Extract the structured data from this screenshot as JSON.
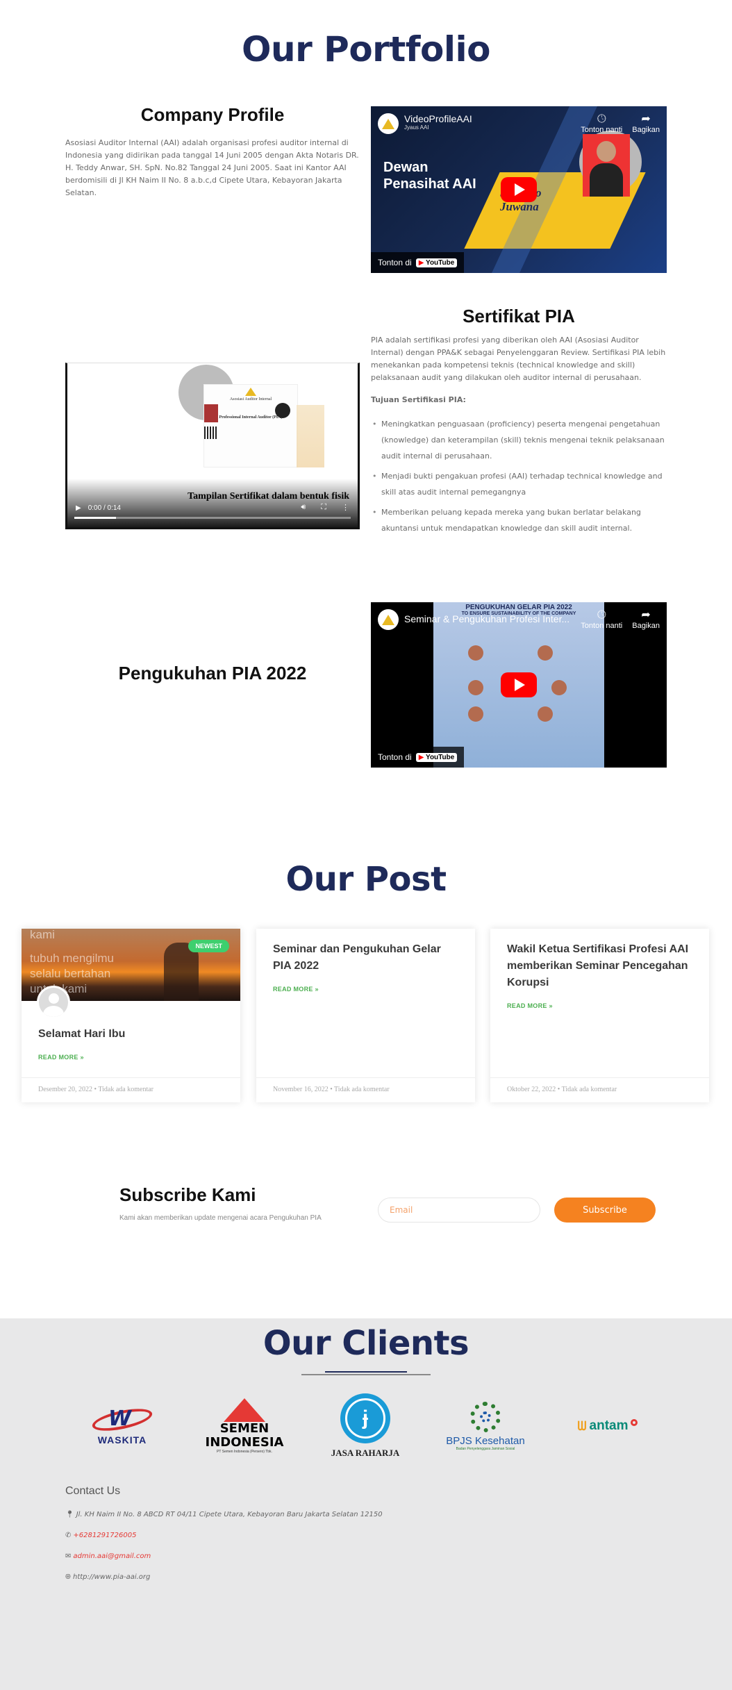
{
  "portfolio": {
    "title": "Our Portfolio",
    "company_profile": {
      "heading": "Company Profile",
      "text": "Asosiasi Auditor Internal (AAI) adalah organisasi profesi auditor internal di Indonesia yang didirikan pada tanggal 14 Juni 2005 dengan Akta Notaris DR. H. Teddy Anwar, SH. SpN. No.82 Tanggal 24 Juni 2005.   Saat ini Kantor AAI berdomisili di Jl KH Naim II No. 8 a.b.c,d Cipete Utara, Kebayoran Jakarta Selatan.",
      "video": {
        "channel_title": "VideoProfileAAI",
        "channel_sub": "Jyaus AAI",
        "watch_later": "Tonton nanti",
        "share": "Bagikan",
        "overlay_line1": "Dewan",
        "overlay_line2": "Penasihat AAI",
        "overlay_name": "Suhanto Juwana",
        "watch_on": "Tonton di",
        "yt_brand": "YouTube"
      }
    },
    "sertifikat": {
      "heading": "Sertifikat PIA",
      "text": "PIA adalah sertifikasi profesi yang diberikan oleh AAI (Asosiasi Auditor Internal) dengan PPA&K sebagai Penyelenggaran Review.  Sertifikasi PIA lebih menekankan pada kompetensi teknis (technical knowledge and skill) pelaksanaan audit yang dilakukan oleh auditor internal di perusahaan.",
      "goals_heading": "Tujuan Sertifikasi PIA:",
      "goals": [
        "Meningkatkan penguasaan (proficiency) peserta mengenai pengetahuan (knowledge) dan keterampilan (skill) teknis mengenai teknik pelaksanaan audit internal di perusahaan.",
        "Menjadi bukti pengakuan profesi (AAI) terhadap technical knowledge and skill atas audit internal pemegangnya",
        "Memberikan peluang kepada mereka yang bukan berlatar belakang akuntansi untuk mendapatkan knowledge dan skill audit internal."
      ],
      "player": {
        "time": "0:00 / 0:14",
        "caption": "Tampilan Sertifikat dalam bentuk fisik",
        "cert_title": "Professional Internal Auditor (PIA)",
        "cert_org": "Asosiasi Auditor Internal"
      }
    },
    "pengukuhan": {
      "heading": "Pengukuhan PIA 2022",
      "video": {
        "channel_title": "Seminar & Pengukuhan Profesi Inter...",
        "watch_later": "Tonton nanti",
        "share": "Bagikan",
        "poster_title": "PENGUKUHAN GELAR PIA 2022",
        "poster_sub": "TO ENSURE SUSTAINABILITY OF THE COMPANY",
        "watch_on": "Tonton di",
        "yt_brand": "YouTube"
      }
    }
  },
  "posts": {
    "title": "Our Post",
    "items": [
      {
        "title": "Selamat Hari Ibu",
        "read_more": "READ MORE »",
        "date": "Desember 20, 2022",
        "comments": "Tidak ada komentar",
        "badge": "NEWEST",
        "thumb_text": "kami\ntubuh mengilmu\nselalu bertahan\nuntuk kami"
      },
      {
        "title": "Seminar dan Pengukuhan Gelar PIA 2022",
        "read_more": "READ MORE »",
        "date": "November 16, 2022",
        "comments": "Tidak ada komentar"
      },
      {
        "title": "Wakil Ketua Sertifikasi Profesi AAI memberikan Seminar Pencegahan Korupsi",
        "read_more": "READ MORE »",
        "date": "Oktober 22, 2022",
        "comments": "Tidak ada komentar"
      }
    ]
  },
  "subscribe": {
    "title": "Subscribe Kami",
    "description": "Kami akan memberikan update mengenai acara Pengukuhan PIA",
    "email_placeholder": "Email",
    "button": "Subscribe"
  },
  "clients": {
    "title": "Our Clients",
    "logos": [
      {
        "name": "WASKITA"
      },
      {
        "name": "SEMEN INDONESIA",
        "sub": "PT Semen Indonesia (Persero) Tbk."
      },
      {
        "name": "JASA RAHARJA"
      },
      {
        "name": "BPJS Kesehatan",
        "sub": "Badan Penyelenggara Jaminan Sosial"
      },
      {
        "name": "antam"
      }
    ]
  },
  "contact": {
    "heading": "Contact Us",
    "address": "Jl. KH Naim II No. 8 ABCD RT 04/11 Cipete Utara, Kebayoran Baru Jakarta Selatan 12150",
    "phone": "+6281291726005",
    "email": "admin.aai@gmail.com",
    "website": "http://www.pia-aai.org"
  },
  "colors": {
    "navy": "#1e2a5a",
    "orange": "#f58220",
    "green": "#3ecf6e",
    "footer_bg": "#e8e8e9"
  }
}
